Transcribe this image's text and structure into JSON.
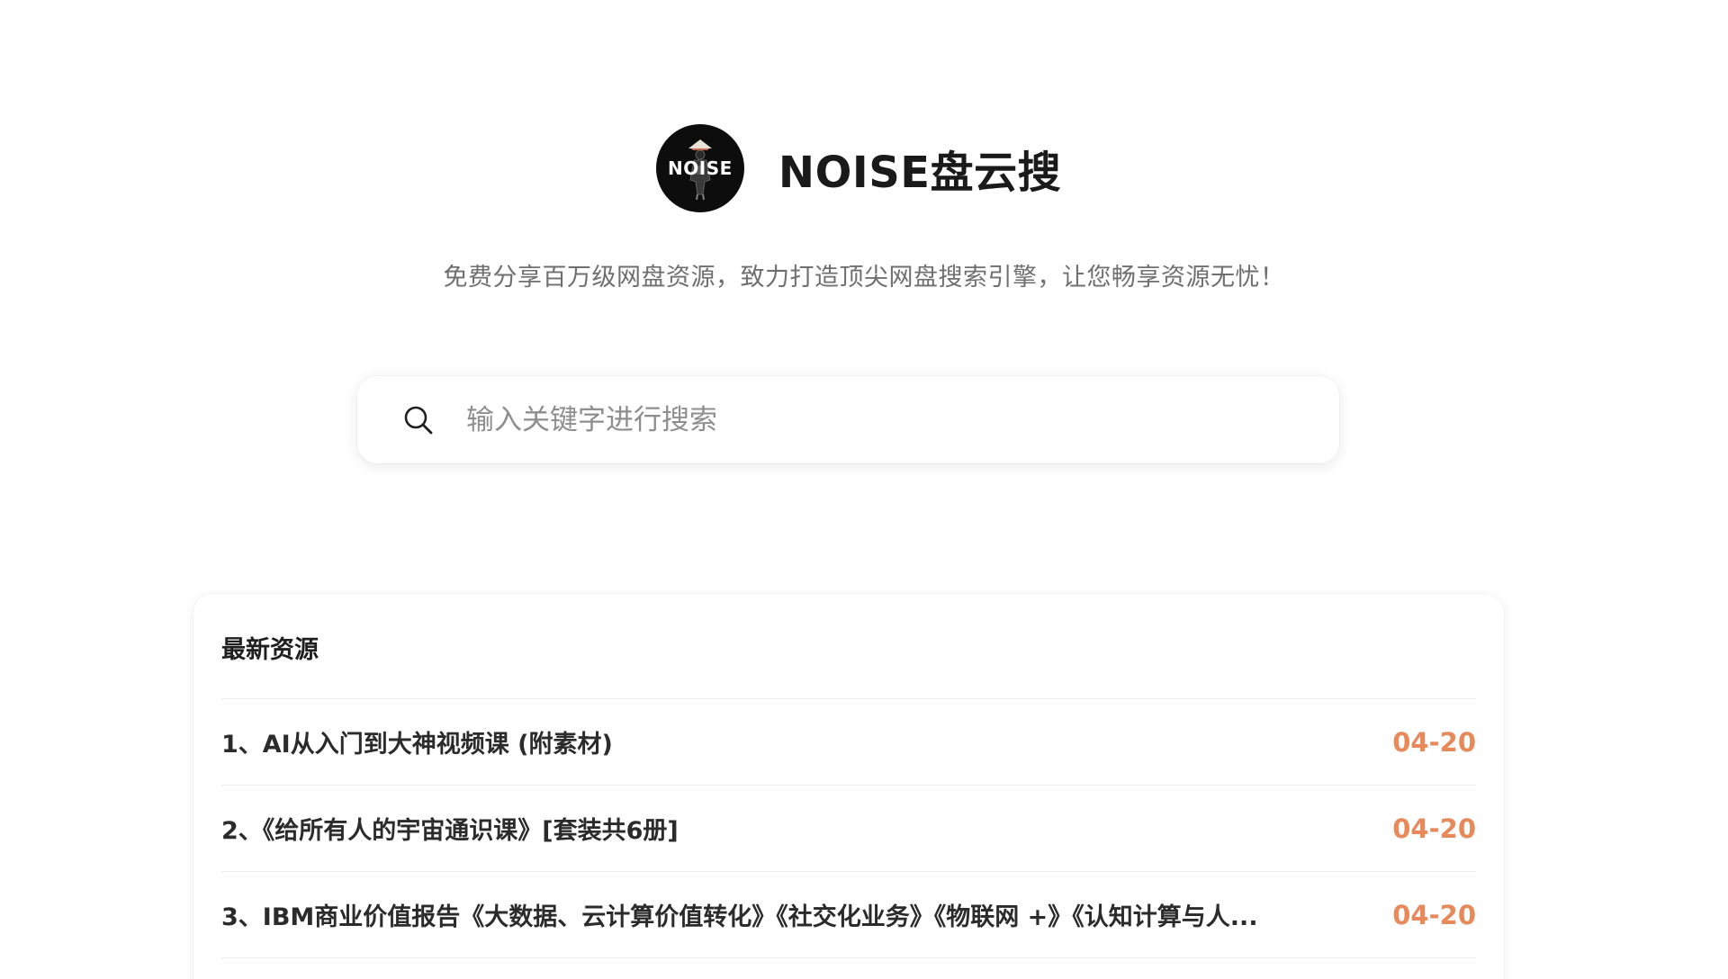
{
  "header": {
    "logo_text": "NOISE",
    "site_title": "NOISE盘云搜",
    "tagline": "免费分享百万级网盘资源，致力打造顶尖网盘搜索引擎，让您畅享资源无忧！"
  },
  "search": {
    "icon": "search-icon",
    "placeholder": "输入关键字进行搜索",
    "value": ""
  },
  "latest": {
    "title": "最新资源",
    "items": [
      {
        "title": "1、AI从入门到大神视频课 (附素材)",
        "date": "04-20"
      },
      {
        "title": "2、《给所有人的宇宙通识课》[套装共6册]",
        "date": "04-20"
      },
      {
        "title": "3、IBM商业价值报告《大数据、云计算价值转化》《社交化业务》《物联网 +》《认知计算与人...",
        "date": "04-20"
      }
    ]
  },
  "colors": {
    "date_accent": "#e8895a",
    "logo_bg": "#0d0d0d",
    "tagline": "#6f6f6f"
  }
}
